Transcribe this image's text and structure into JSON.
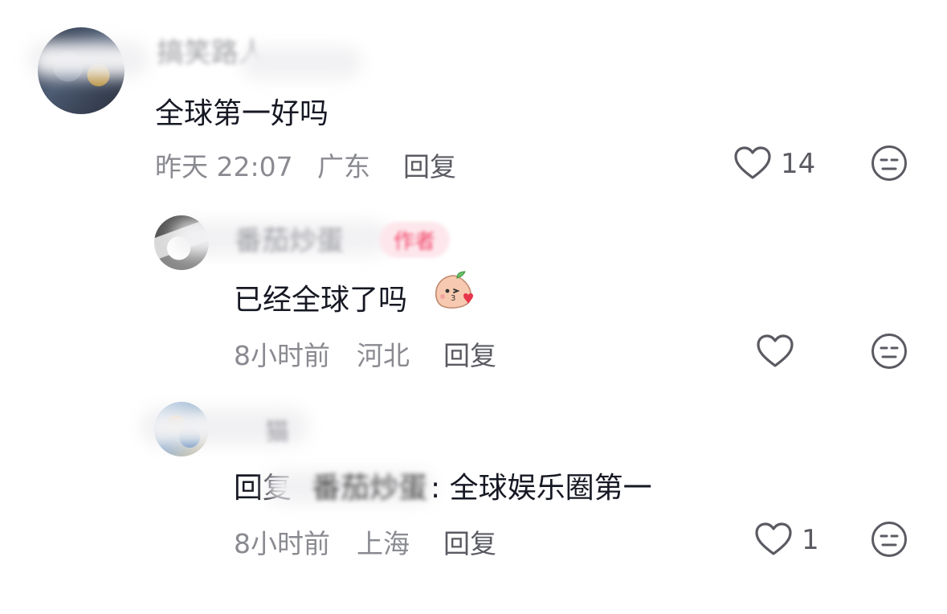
{
  "comments": [
    {
      "username": "搞笑路人",
      "text": "全球第一好吗",
      "time": "昨天 22:07",
      "location": "广东",
      "reply_label": "回复",
      "likes": "14"
    },
    {
      "username": "番茄炒蛋",
      "badge": "作者",
      "text": "已经全球了吗",
      "emoji": "kiss-face-emoji",
      "time": "8小时前",
      "location": "河北",
      "reply_label": "回复",
      "likes": ""
    },
    {
      "username": "猫",
      "reply_prefix": "回复",
      "reply_to": "番茄炒蛋",
      "text": ": 全球娱乐圈第一",
      "time": "8小时前",
      "location": "上海",
      "reply_label": "回复",
      "likes": "1"
    }
  ],
  "icons": {
    "like": "heart-outline-icon",
    "emoji": "neutral-face-icon"
  },
  "colors": {
    "text": "#161823",
    "meta": "#8a8b91",
    "author_badge_bg": "#fde7ec",
    "author_badge_text": "#f2466a"
  }
}
